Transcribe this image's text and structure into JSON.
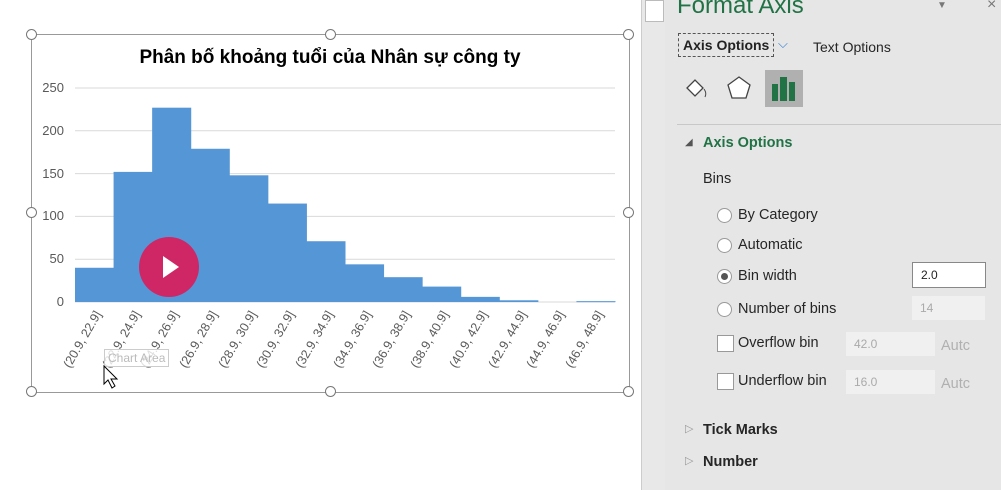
{
  "chart_data": {
    "type": "bar",
    "title": "Phân bố khoảng tuổi của Nhân sự công ty",
    "categories": [
      "(20.9, 22.9]",
      "(22.9, 24.9]",
      "(24.9, 26.9]",
      "(26.9, 28.9]",
      "(28.9, 30.9]",
      "(30.9, 32.9]",
      "(32.9, 34.9]",
      "(34.9, 36.9]",
      "(36.9, 38.9]",
      "(38.9, 40.9]",
      "(40.9, 42.9]",
      "(42.9, 44.9]",
      "(44.9, 46.9]",
      "(46.9, 48.9]"
    ],
    "values": [
      40,
      152,
      227,
      179,
      148,
      115,
      71,
      44,
      29,
      18,
      6,
      2,
      0,
      1
    ],
    "yticks": [
      "0",
      "50",
      "100",
      "150",
      "200",
      "250"
    ],
    "ylim": [
      0,
      250
    ],
    "xlabel": "",
    "ylabel": "",
    "grid": true,
    "bar_color": "#5596d6"
  },
  "tooltip": "Chart Area",
  "panel": {
    "title": "Format Axis",
    "tab_axis": "Axis Options",
    "tab_text": "Text Options",
    "section": "Axis Options",
    "bins_label": "Bins",
    "by_category": "By Category",
    "automatic": "Automatic",
    "bin_width": "Bin width",
    "bin_width_value": "2.0",
    "number_of_bins": "Number of bins",
    "number_of_bins_value": "14",
    "overflow": "Overflow bin",
    "overflow_value": "42.0",
    "underflow": "Underflow bin",
    "underflow_value": "16.0",
    "auto": "Autc",
    "tick_marks": "Tick Marks",
    "number": "Number",
    "accent": "#217346"
  }
}
